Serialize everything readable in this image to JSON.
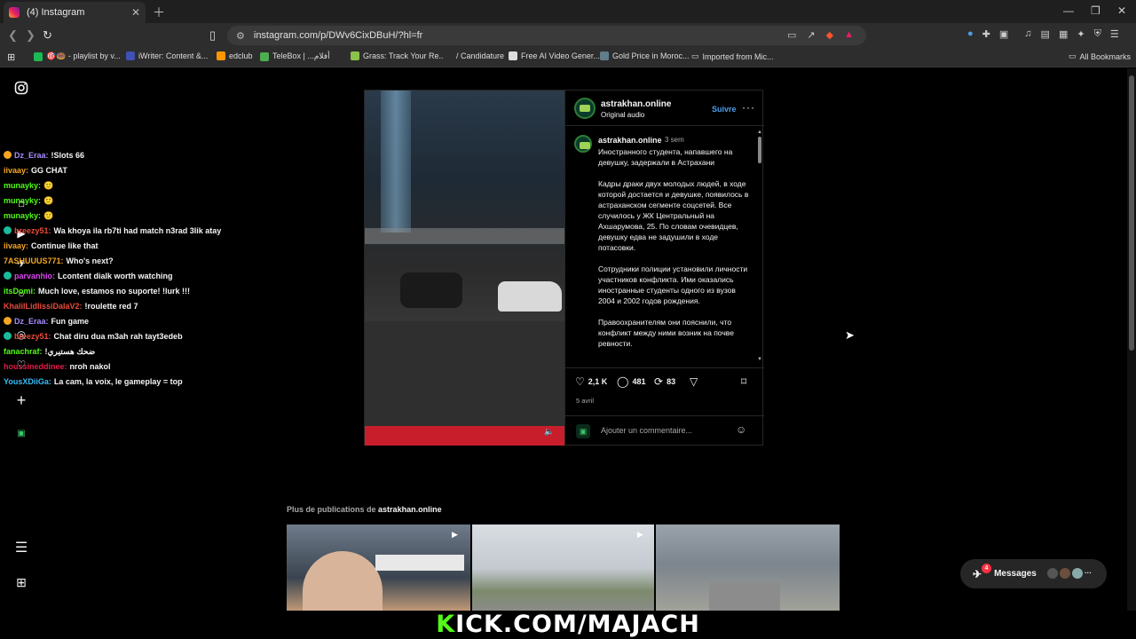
{
  "browser": {
    "tab_title": "(4) Instagram",
    "url": "instagram.com/p/DWv6CixDBuH/?hl=fr",
    "bookmarks": [
      {
        "label": "🎯🍩 - playlist by v...",
        "color": "#1db954"
      },
      {
        "label": "iWriter: Content &...",
        "color": "#3f51b5"
      },
      {
        "label": "edclub",
        "color": "#ff9800"
      },
      {
        "label": "TeleBox | ...أفلام",
        "color": "#4caf50"
      },
      {
        "label": "Grass: Track Your Re...",
        "color": "#8bc34a"
      },
      {
        "label": "/ Candidature",
        "color": "#2d2d2d"
      },
      {
        "label": "Free AI Video Gener...",
        "color": "#dddddd"
      },
      {
        "label": "Gold Price in Moroc...",
        "color": "#607d8b"
      },
      {
        "label": "Imported from Mic...",
        "color": "#2d2d2d"
      }
    ],
    "all_bookmarks": "All Bookmarks"
  },
  "chat": [
    {
      "user": "Dz_Eraa:",
      "text": "!Slots 66",
      "color": "#a78bfa",
      "badge": "#f5a623"
    },
    {
      "user": "iivaay:",
      "text": "GG CHAT",
      "color": "#f5a623",
      "badge": ""
    },
    {
      "user": "munayky:",
      "text": "🙂",
      "color": "#53fc18",
      "badge": ""
    },
    {
      "user": "munayky:",
      "text": "🙂",
      "color": "#53fc18",
      "badge": ""
    },
    {
      "user": "munayky:",
      "text": "🙂",
      "color": "#53fc18",
      "badge": ""
    },
    {
      "user": "breezy51:",
      "text": "Wa khoya ila rb7ti had match n3rad 3lik atay",
      "color": "#e74c3c",
      "badge": "#1abc9c"
    },
    {
      "user": "iivaay:",
      "text": "Continue like that",
      "color": "#f5a623",
      "badge": ""
    },
    {
      "user": "7ASHUUUS771:",
      "text": "Who's next?",
      "color": "#f5a623",
      "badge": ""
    },
    {
      "user": "parvanhio:",
      "text": "Lcontent dialk worth watching",
      "color": "#d946ef",
      "badge": "#1abc9c"
    },
    {
      "user": "itsDomi:",
      "text": "Much love, estamos no suporte! !lurk !!!",
      "color": "#53fc18",
      "badge": ""
    },
    {
      "user": "KhalilLidlissiDalaV2:",
      "text": "!roulette red 7",
      "color": "#e74c3c",
      "badge": ""
    },
    {
      "user": "Dz_Eraa:",
      "text": "Fun game",
      "color": "#a78bfa",
      "badge": "#f5a623"
    },
    {
      "user": "breezy51:",
      "text": "Chat diru dua m3ah rah tayt3edeb",
      "color": "#e74c3c",
      "badge": "#1abc9c"
    },
    {
      "user": "fanachraf:",
      "text": "!ضحك هستيري",
      "color": "#53fc18",
      "badge": ""
    },
    {
      "user": "houssineddinee:",
      "text": "nroh nakol",
      "color": "#e11d48",
      "badge": ""
    },
    {
      "user": "YousXDiiGa:",
      "text": "La cam, la voix, le gameplay = top",
      "color": "#38bdf8",
      "badge": ""
    }
  ],
  "post": {
    "username": "astrakhan.online",
    "audio": "Original audio",
    "follow": "Suivre",
    "more": "···",
    "caption_time": "3 sem",
    "caption": [
      "Иностранного студента, напавшего на девушку, задержали в Астрахани",
      "Кадры драки двух молодых людей, в ходе которой достается и девушке, появилось в астраханском сегменте соцсетей. Все случилось у ЖК Центральный на Ахшарумова, 25. По словам очевидцев, девушку едва не задушили в ходе потасовки.",
      "Сотрудники полиции установили личности участников конфликта. Ими оказались иностранные студенты одного из вузов 2004 и 2002 годов рождения.",
      "Правоохранителям они пояснили, что конфликт между ними возник на почве ревности."
    ],
    "likes": "2,1 K",
    "comments": "481",
    "reposts": "83",
    "date": "5 avril",
    "comment_placeholder": "Ajouter un commentaire..."
  },
  "more_posts": {
    "prefix": "Plus de publications de",
    "username": "astrakhan.online"
  },
  "messages": {
    "label": "Messages",
    "count": "4"
  },
  "banner": {
    "k": "K",
    "rest": "ICK.COM/MAJACH"
  },
  "colors": {
    "accent_blue": "#4c9eeb",
    "kick_green": "#53fc18"
  }
}
